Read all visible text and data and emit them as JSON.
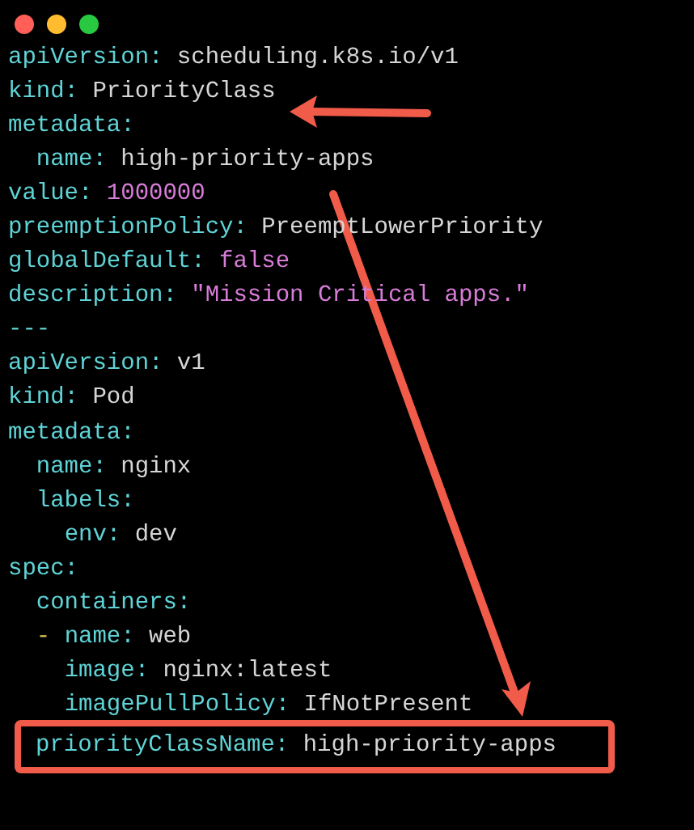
{
  "lines": [
    {
      "kind": "scalar",
      "key": "apiVersion:",
      "value": "scheduling.k8s.io/v1"
    },
    {
      "kind": "scalar",
      "key": "kind:",
      "value": "PriorityClass"
    },
    {
      "kind": "mapping",
      "key": "metadata:",
      "children": [
        {
          "kind": "scalar",
          "key": "name:",
          "value": "high-priority-apps"
        }
      ]
    },
    {
      "kind": "literal",
      "key": "value:",
      "value": "1000000"
    },
    {
      "kind": "scalar",
      "key": "preemptionPolicy:",
      "value": "PreemptLowerPriority"
    },
    {
      "kind": "literal",
      "key": "globalDefault:",
      "value": "false"
    },
    {
      "kind": "literal",
      "key": "description:",
      "value": "\"Mission Critical apps.\""
    },
    {
      "kind": "separator",
      "text": "---"
    },
    {
      "kind": "scalar",
      "key": "apiVersion:",
      "value": "v1"
    },
    {
      "kind": "scalar",
      "key": "kind:",
      "value": "Pod"
    },
    {
      "kind": "mapping",
      "key": "metadata:",
      "children": [
        {
          "kind": "scalar",
          "key": "name:",
          "value": "nginx"
        },
        {
          "kind": "mapping",
          "key": "labels:",
          "children": [
            {
              "kind": "scalar",
              "key": "env:",
              "value": "dev"
            }
          ]
        }
      ]
    },
    {
      "kind": "mapping",
      "key": "spec:",
      "children": [
        {
          "kind": "mapping",
          "key": "containers:",
          "children": [
            {
              "kind": "scalar",
              "key": "name:",
              "value": "web",
              "bullet": "-",
              "children": [
                {
                  "kind": "scalar",
                  "key": "image:",
                  "value": "nginx:latest"
                },
                {
                  "kind": "scalar",
                  "key": "imagePullPolicy:",
                  "value": "IfNotPresent"
                }
              ]
            }
          ]
        },
        {
          "kind": "scalar",
          "key": "priorityClassName:",
          "value": "high-priority-apps",
          "highlighted": true
        }
      ]
    }
  ]
}
